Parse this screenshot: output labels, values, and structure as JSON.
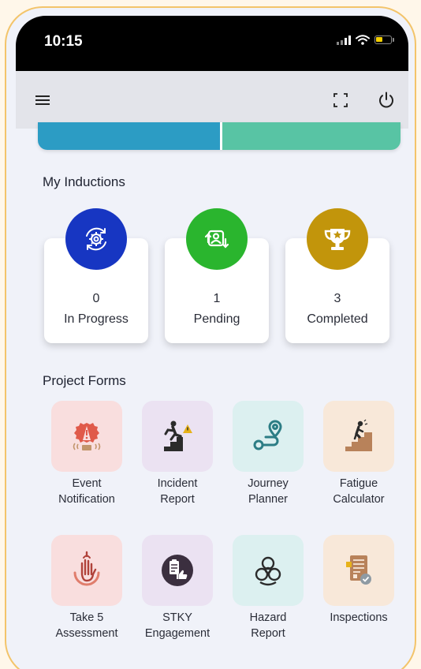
{
  "status": {
    "time": "10:15"
  },
  "inductions": {
    "title": "My Inductions",
    "cards": [
      {
        "count": "0",
        "label": "In Progress",
        "color": "#1736c2",
        "icon": "process-gear-icon"
      },
      {
        "count": "1",
        "label": "Pending",
        "color": "#2ab52e",
        "icon": "pending-user-icon"
      },
      {
        "count": "3",
        "label": "Completed",
        "color": "#c2950b",
        "icon": "trophy-icon"
      }
    ]
  },
  "project_forms": {
    "title": "Project Forms",
    "items": [
      {
        "line1": "Event",
        "line2": "Notification",
        "tile_color": "#f9dede",
        "icon": "alert-gear-icon"
      },
      {
        "line1": "Incident",
        "line2": "Report",
        "tile_color": "#ebe2f2",
        "icon": "slip-stairs-icon"
      },
      {
        "line1": "Journey",
        "line2": "Planner",
        "tile_color": "#dcf0f0",
        "icon": "route-pin-icon"
      },
      {
        "line1": "Fatigue",
        "line2": "Calculator",
        "tile_color": "#f8e8d9",
        "icon": "tired-stairs-icon"
      },
      {
        "line1": "Take 5",
        "line2": "Assessment",
        "tile_color": "#f9dede",
        "icon": "hand-stop-icon"
      },
      {
        "line1": "STKY",
        "line2": "Engagement",
        "tile_color": "#ebe2f2",
        "icon": "clipboard-thumb-icon"
      },
      {
        "line1": "Hazard",
        "line2": "Report",
        "tile_color": "#dcf0f0",
        "icon": "biohazard-icon"
      },
      {
        "line1": "Inspections",
        "line2": "",
        "tile_color": "#f8e8d9",
        "icon": "inspection-form-icon"
      }
    ]
  }
}
